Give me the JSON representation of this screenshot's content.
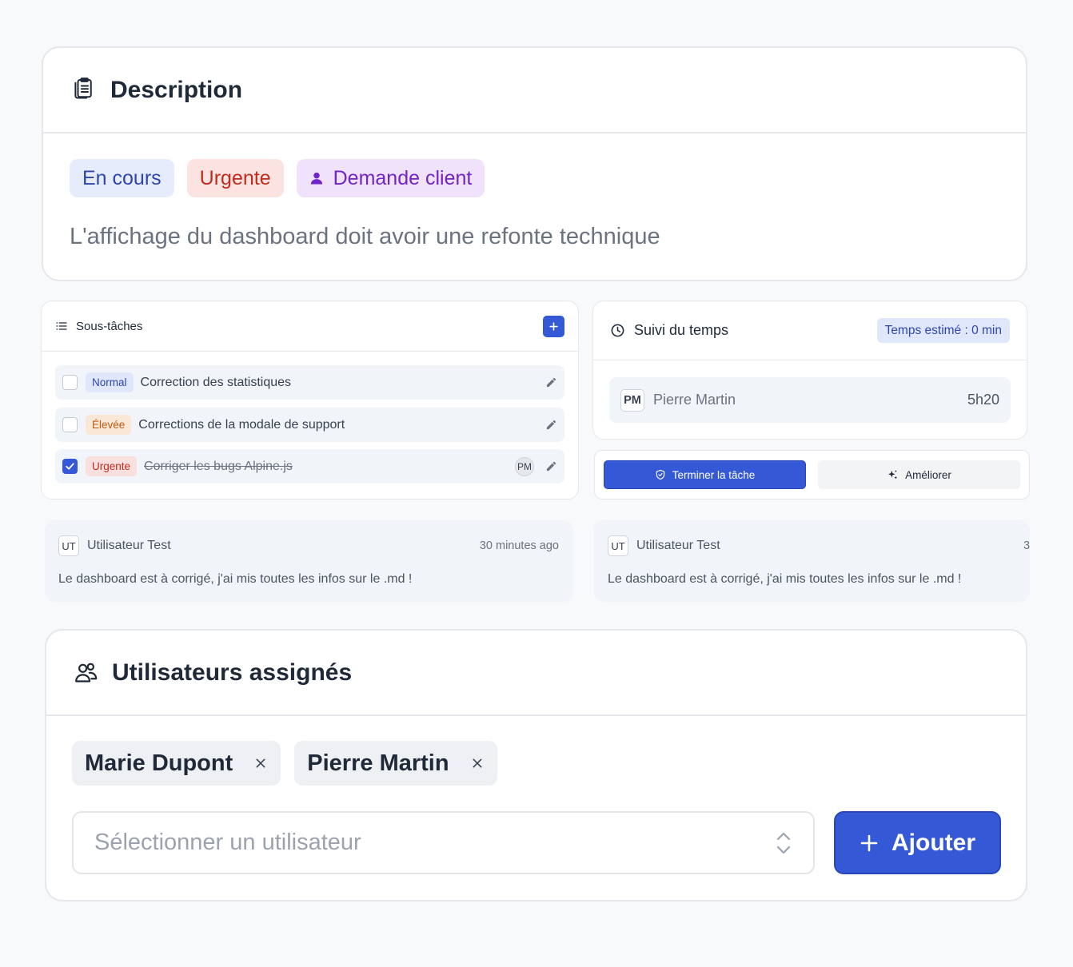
{
  "description": {
    "title": "Description",
    "badges": [
      "En cours",
      "Urgente",
      "Demande client"
    ],
    "text": "L'affichage du dashboard doit avoir une refonte technique"
  },
  "subtasks": {
    "title": "Sous-tâches",
    "items": [
      {
        "priority": "Normal",
        "label": "Correction des statistiques",
        "checked": false
      },
      {
        "priority": "Élevée",
        "label": "Corrections de la modale de support",
        "checked": false
      },
      {
        "priority": "Urgente",
        "label": "Corriger les bugs Alpine.js",
        "checked": true,
        "assignee": "PM"
      }
    ]
  },
  "time_tracking": {
    "title": "Suivi du temps",
    "estimate": "Temps estimé : 0 min",
    "entries": [
      {
        "initials": "PM",
        "name": "Pierre Martin",
        "duration": "5h20"
      }
    ]
  },
  "actions": {
    "finish": "Terminer la tâche",
    "improve": "Améliorer"
  },
  "comments": [
    {
      "initials": "UT",
      "author": "Utilisateur Test",
      "time": "30 minutes ago",
      "text": "Le dashboard est à corrigé, j'ai mis toutes les infos sur le .md !"
    },
    {
      "initials": "UT",
      "author": "Utilisateur Test",
      "time": "3",
      "text": "Le dashboard est à corrigé, j'ai mis toutes les infos sur le .md !"
    }
  ],
  "assigned_users": {
    "title": "Utilisateurs assignés",
    "users": [
      "Marie Dupont",
      "Pierre Martin"
    ],
    "select_placeholder": "Sélectionner un utilisateur",
    "add_label": "Ajouter"
  },
  "colors": {
    "primary": "#3558d6",
    "status_blue_bg": "#e6ecfb",
    "urgent_bg": "#fbe3e1",
    "client_bg": "#f0e2fb"
  }
}
